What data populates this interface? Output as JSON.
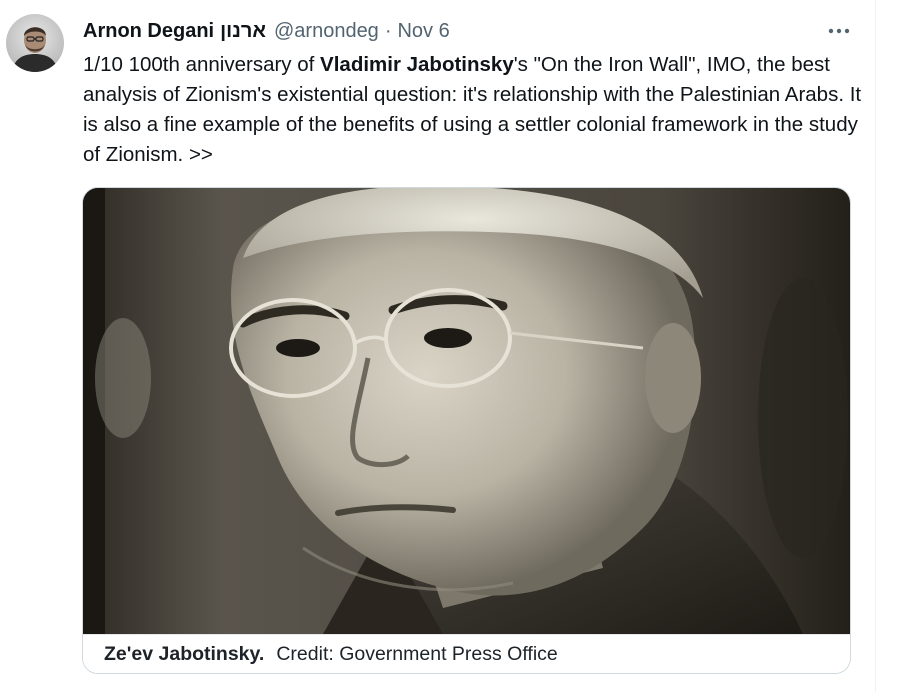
{
  "tweet": {
    "display_name": "Arnon Degani",
    "hebrew_name": "ארנון",
    "handle": "@arnondeg",
    "separator": "·",
    "timestamp": "Nov 6",
    "text": {
      "part1": "1/10 100th anniversary of ",
      "bold": "Vladimir Jabotinsky",
      "part2": "'s \"On the Iron Wall\", IMO, the best analysis of Zionism's existential question: it's relationship with the Palestinian Arabs. It is also a fine example of the benefits of using a settler colonial framework in the study of Zionism. >>"
    },
    "media": {
      "caption_name": "Ze'ev Jabotinsky.",
      "caption_credit": "Credit: Government Press Office"
    }
  },
  "icons": {
    "more": "more-horizontal-icon"
  },
  "colors": {
    "text_primary": "#0f1419",
    "text_secondary": "#536471",
    "border": "#cfd9de"
  }
}
